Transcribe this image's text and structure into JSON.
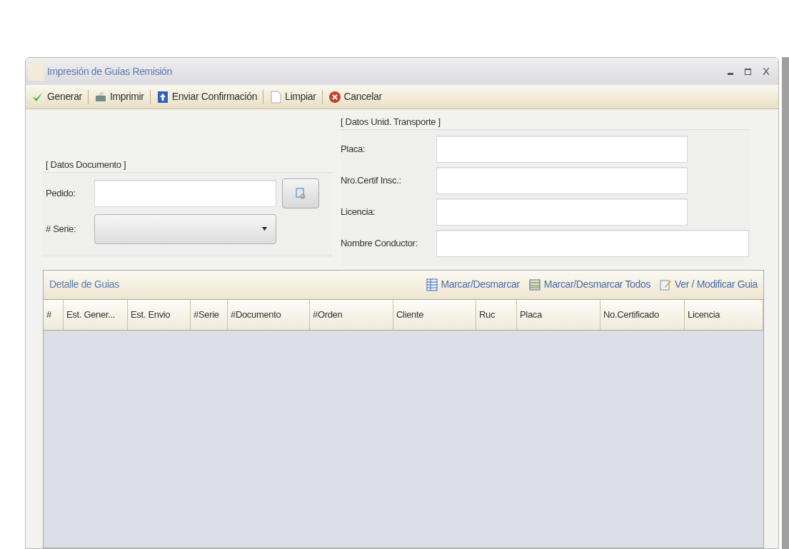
{
  "window": {
    "title": "Impresión de Guías Remisión",
    "close": "X"
  },
  "toolbar": [
    {
      "label": "Generar",
      "kind": "check"
    },
    {
      "label": "Imprimir",
      "kind": "print"
    },
    {
      "label": "Enviar Confirmación",
      "kind": "send"
    },
    {
      "label": "Limpiar",
      "kind": "page"
    },
    {
      "label": "Cancelar",
      "kind": "cancel"
    }
  ],
  "documento": {
    "title": "[ Datos Documento ]",
    "pedido_label": "Pedido:",
    "serie_label": "# Serie:"
  },
  "transporte": {
    "title": "[ Datos Unid. Transporte ]",
    "fields": [
      {
        "label": "Placa:",
        "wide": false
      },
      {
        "label": "Nro.Certif Insc.:",
        "wide": false
      },
      {
        "label": "Licencia:",
        "wide": false
      },
      {
        "label": "Nombre Conductor:",
        "wide": true
      }
    ]
  },
  "detalle": {
    "title": "Detalle de Guias",
    "actions": [
      {
        "label": "Marcar/Desmarcar",
        "kind": "grid"
      },
      {
        "label": "Marcar/Desmarcar Todos",
        "kind": "grid-all"
      },
      {
        "label": "Ver / Modificar Guia",
        "kind": "edit"
      }
    ]
  },
  "table": {
    "columns": [
      "#",
      "Est. Gener...",
      "Est. Envio",
      "#Serie",
      "#Documento",
      "#Orden",
      "Cliente",
      "Ruc",
      "Placa",
      "No.Certificado",
      "Licencia"
    ]
  }
}
